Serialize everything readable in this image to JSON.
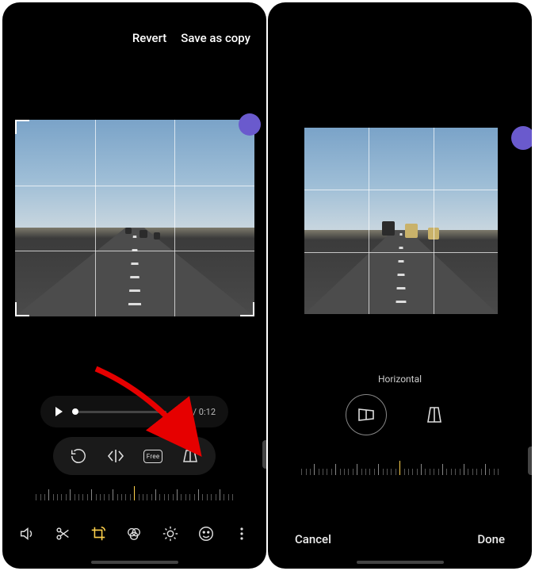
{
  "left": {
    "actions": {
      "revert": "Revert",
      "save_as_copy": "Save as copy"
    },
    "playback": {
      "time": "0:00 / 0:12"
    },
    "crop_tools": {
      "rotate": "rotate-icon",
      "flip_h": "flip-horizontal-icon",
      "ratio_label": "Free",
      "perspective": "perspective-icon"
    },
    "bottom_tools": {
      "sound": "volume-icon",
      "trim": "scissors-icon",
      "crop": "crop-rotate-icon",
      "filters": "filters-icon",
      "adjust": "brightness-icon",
      "decorate": "emoji-icon",
      "more": "more-icon"
    }
  },
  "right": {
    "perspective_label": "Horizontal",
    "footer": {
      "cancel": "Cancel",
      "done": "Done"
    }
  }
}
